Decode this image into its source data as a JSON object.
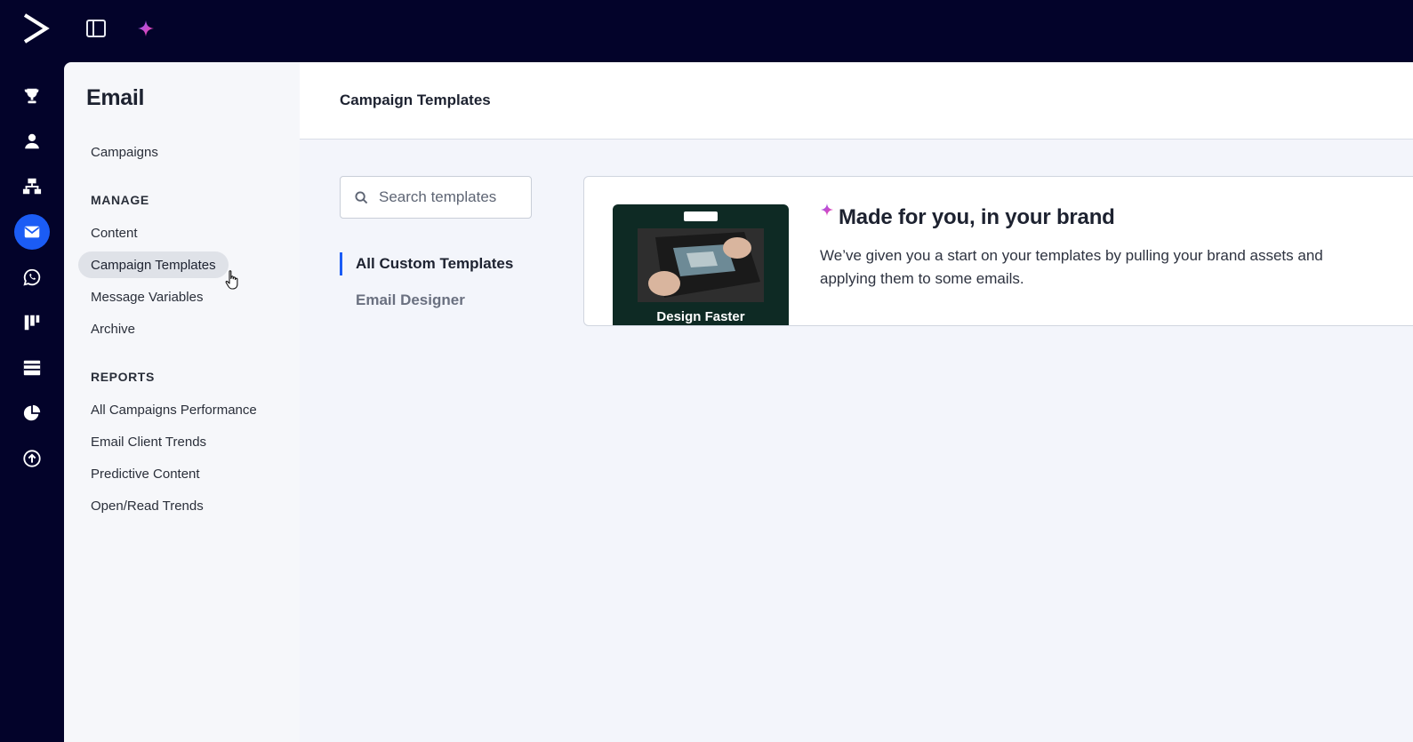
{
  "app": {
    "logo_icon": "activecampaign-chevron-logo-icon",
    "panel_toggle_icon": "sidebar-panel-icon",
    "ai_icon": "sparkle-icon",
    "accent_color": "#1b5cf5",
    "nav_background": "#03032a"
  },
  "rail": {
    "items": [
      {
        "icon": "trophy-icon",
        "active": false
      },
      {
        "icon": "contact-person-icon",
        "active": false
      },
      {
        "icon": "automation-tree-icon",
        "active": false
      },
      {
        "icon": "email-envelope-icon",
        "active": true
      },
      {
        "icon": "whatsapp-icon",
        "active": false
      },
      {
        "icon": "pipeline-bars-icon",
        "active": false
      },
      {
        "icon": "landing-pages-icon",
        "active": false
      },
      {
        "icon": "reports-pie-icon",
        "active": false
      },
      {
        "icon": "upload-arrow-icon",
        "active": false
      }
    ]
  },
  "subnav": {
    "title": "Email",
    "campaigns": "Campaigns",
    "manage_heading": "MANAGE",
    "manage_items": [
      "Content",
      "Campaign Templates",
      "Message Variables",
      "Archive"
    ],
    "reports_heading": "REPORTS",
    "reports_items": [
      "All Campaigns Performance",
      "Email Client Trends",
      "Predictive Content",
      "Open/Read Trends"
    ]
  },
  "main": {
    "title": "Campaign Templates",
    "search": {
      "placeholder": "Search templates",
      "value": ""
    },
    "filters": [
      "All Custom Templates",
      "Email Designer"
    ]
  },
  "promo": {
    "title": "Made for you, in your brand",
    "body": "We’ve given you a start on your templates by pulling your brand assets and applying them to some emails.",
    "thumbnail_caption": "Design Faster"
  }
}
